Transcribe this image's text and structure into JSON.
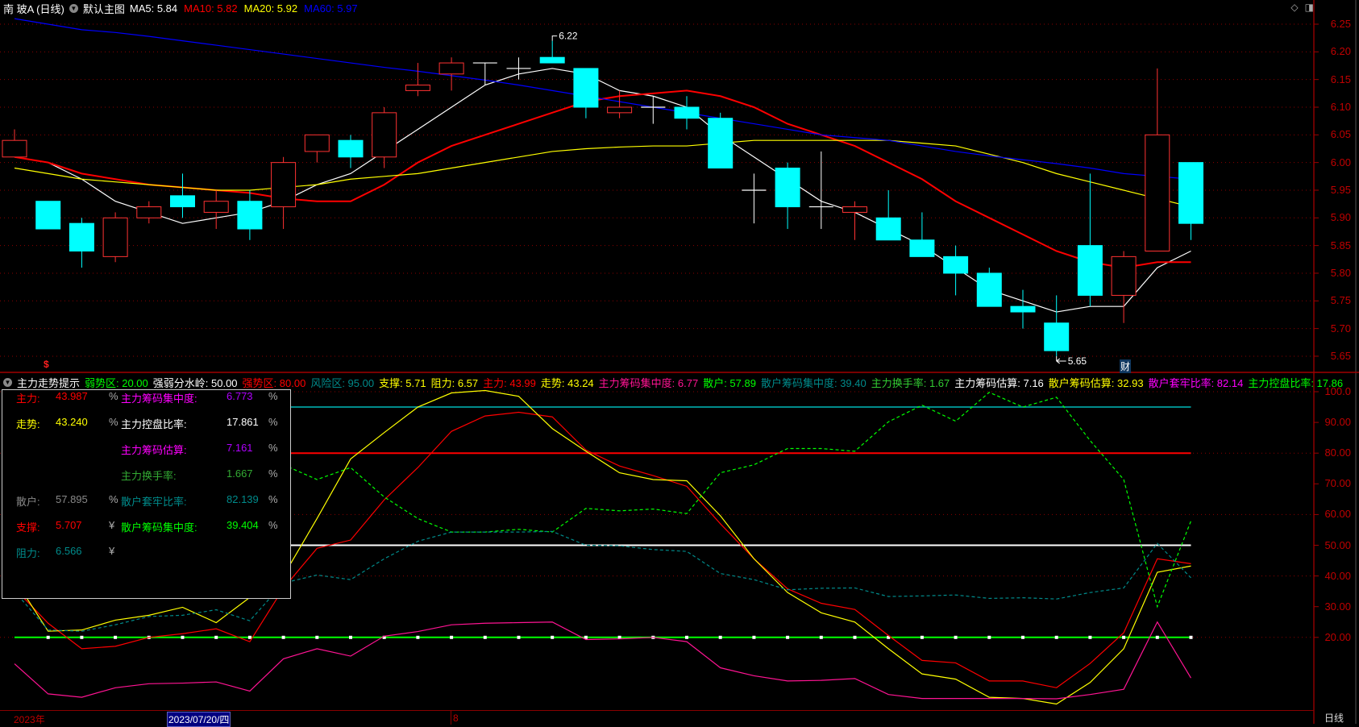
{
  "main_header": {
    "symbol": "南 玻A (日线)",
    "template": "默认主图",
    "ma": [
      {
        "label": "MA5: 5.84",
        "color": "#ffffff"
      },
      {
        "label": "MA10: 5.82",
        "color": "#ff0000"
      },
      {
        "label": "MA20: 5.92",
        "color": "#ffff00"
      },
      {
        "label": "MA60: 5.97",
        "color": "#0000ff"
      }
    ]
  },
  "indicator_header": {
    "name": "主力走势提示",
    "items": [
      {
        "label": "弱势区: 20.00",
        "color": "#00ff00"
      },
      {
        "label": "强弱分水岭: 50.00",
        "color": "#ffffff"
      },
      {
        "label": "强势区: 80.00",
        "color": "#ff0000"
      },
      {
        "label": "风险区: 95.00",
        "color": "#008b8b"
      },
      {
        "label": "支撑: 5.71",
        "color": "#ffff00"
      },
      {
        "label": "阻力: 6.57",
        "color": "#ffff00"
      },
      {
        "label": "主力: 43.99",
        "color": "#ff0000"
      },
      {
        "label": "走势: 43.24",
        "color": "#ffff00"
      },
      {
        "label": "主力筹码集中度: 6.77",
        "color": "#ff1493"
      },
      {
        "label": "散户: 57.89",
        "color": "#00ff00"
      },
      {
        "label": "散户筹码集中度: 39.40",
        "color": "#008b8b"
      },
      {
        "label": "主力换手率: 1.67",
        "color": "#33cc33"
      },
      {
        "label": "主力筹码估算: 7.16",
        "color": "#ffffff"
      },
      {
        "label": "散户筹码估算: 32.93",
        "color": "#ffff00"
      },
      {
        "label": "散户套牢比率: 82.14",
        "color": "#ff00ff"
      },
      {
        "label": "主力控盘比率: 17.86",
        "color": "#00ff00"
      }
    ]
  },
  "info_panel": {
    "rows": [
      {
        "l1": "主力:",
        "v1": "43.987",
        "u1": "%",
        "l2": "主力筹码集中度:",
        "v2": "6.773",
        "u2": "%",
        "c1": "#ff0000",
        "c2": "#ff00ff",
        "cv2": "#b000ff"
      },
      {
        "l1": "走势:",
        "v1": "43.240",
        "u1": "%",
        "l2": "主力控盘比率:",
        "v2": "17.861",
        "u2": "%",
        "c1": "#ffff00",
        "c2": "#ffffff",
        "cv2": "#ffffff"
      },
      {
        "l1": "",
        "v1": "",
        "u1": "",
        "l2": "主力筹码估算:",
        "v2": "7.161",
        "u2": "%",
        "c1": "#fff",
        "c2": "#ff00ff",
        "cv2": "#b000ff"
      },
      {
        "l1": "",
        "v1": "",
        "u1": "",
        "l2": "主力换手率:",
        "v2": "1.667",
        "u2": "%",
        "c1": "#fff",
        "c2": "#33aa33",
        "cv2": "#33aa33"
      },
      {
        "l1": "散户:",
        "v1": "57.895",
        "u1": "%",
        "l2": "散户套牢比率:",
        "v2": "82.139",
        "u2": "%",
        "c1": "#888888",
        "c2": "#008b8b",
        "cv2": "#008b8b"
      },
      {
        "l1": "支撑:",
        "v1": "5.707",
        "u1": "¥",
        "l2": "散户筹码集中度:",
        "v2": "39.404",
        "u2": "%",
        "c1": "#ff0000",
        "c2": "#00ff00",
        "cv2": "#00ff00"
      },
      {
        "l1": "阻力:",
        "v1": "6.566",
        "u1": "¥",
        "l2": "",
        "v2": "",
        "u2": "",
        "c1": "#008b8b",
        "c2": "#fff",
        "cv2": "#fff"
      }
    ]
  },
  "date_axis": {
    "year": "2023年",
    "cursor_date": "2023/07/20/四",
    "month": "8",
    "period": "日线"
  },
  "markers": {
    "event_s": "$",
    "event_cai": "财"
  },
  "colors": {
    "up": "#ff3232",
    "down": "#00ffff",
    "doji": "#ffffff",
    "grid": "#8b0000",
    "axis": "#c00000"
  },
  "chart_data": [
    {
      "type": "candlestick",
      "title": "南 玻A (日线)",
      "ylim": [
        5.62,
        6.27
      ],
      "yticks": [
        "6.25",
        "6.20",
        "6.15",
        "6.10",
        "6.05",
        "6.00",
        "5.95",
        "5.90",
        "5.85",
        "5.80",
        "5.75",
        "5.70",
        "5.65"
      ],
      "max_label": "6.22",
      "min_label": "5.65",
      "candles_ohlc": [
        [
          6.01,
          6.06,
          6.01,
          6.04
        ],
        [
          5.93,
          5.93,
          5.88,
          5.88
        ],
        [
          5.89,
          5.9,
          5.81,
          5.84
        ],
        [
          5.83,
          5.91,
          5.82,
          5.9
        ],
        [
          5.9,
          5.93,
          5.89,
          5.92
        ],
        [
          5.94,
          5.98,
          5.9,
          5.92
        ],
        [
          5.91,
          5.95,
          5.88,
          5.93
        ],
        [
          5.93,
          5.95,
          5.86,
          5.88
        ],
        [
          5.92,
          6.01,
          5.88,
          6.0
        ],
        [
          6.02,
          6.05,
          6.0,
          6.05
        ],
        [
          6.04,
          6.05,
          5.99,
          6.01
        ],
        [
          6.01,
          6.1,
          5.99,
          6.09
        ],
        [
          6.13,
          6.18,
          6.12,
          6.14
        ],
        [
          6.16,
          6.19,
          6.13,
          6.18
        ],
        [
          6.18,
          6.18,
          6.14,
          6.18
        ],
        [
          6.17,
          6.19,
          6.15,
          6.17
        ],
        [
          6.19,
          6.22,
          6.18,
          6.18
        ],
        [
          6.17,
          6.17,
          6.08,
          6.1
        ],
        [
          6.09,
          6.13,
          6.08,
          6.1
        ],
        [
          6.1,
          6.12,
          6.07,
          6.1
        ],
        [
          6.1,
          6.12,
          6.06,
          6.08
        ],
        [
          6.08,
          6.09,
          5.99,
          5.99
        ],
        [
          5.95,
          5.98,
          5.89,
          5.95
        ],
        [
          5.99,
          6.0,
          5.88,
          5.92
        ],
        [
          5.92,
          6.02,
          5.88,
          5.92
        ],
        [
          5.91,
          5.93,
          5.86,
          5.92
        ],
        [
          5.9,
          5.95,
          5.86,
          5.86
        ],
        [
          5.86,
          5.91,
          5.83,
          5.83
        ],
        [
          5.83,
          5.85,
          5.76,
          5.8
        ],
        [
          5.8,
          5.81,
          5.74,
          5.74
        ],
        [
          5.74,
          5.77,
          5.7,
          5.73
        ],
        [
          5.71,
          5.76,
          5.65,
          5.66
        ],
        [
          5.85,
          5.98,
          5.74,
          5.76
        ],
        [
          5.76,
          5.84,
          5.71,
          5.83
        ],
        [
          5.84,
          6.17,
          5.84,
          6.05
        ],
        [
          6.0,
          6.0,
          5.86,
          5.89
        ]
      ],
      "series": [
        {
          "name": "MA5",
          "color": "#ffffff",
          "values": [
            6.01,
            6.0,
            5.97,
            5.93,
            5.91,
            5.89,
            5.9,
            5.91,
            5.93,
            5.96,
            5.98,
            6.02,
            6.06,
            6.1,
            6.14,
            6.16,
            6.17,
            6.16,
            6.13,
            6.12,
            6.1,
            6.05,
            6.01,
            5.97,
            5.93,
            5.91,
            5.88,
            5.85,
            5.81,
            5.77,
            5.75,
            5.73,
            5.74,
            5.74,
            5.81,
            5.84
          ]
        },
        {
          "name": "MA10",
          "color": "#ff0000",
          "values": [
            6.01,
            6.0,
            5.98,
            5.97,
            5.96,
            5.955,
            5.95,
            5.945,
            5.935,
            5.93,
            5.93,
            5.96,
            6.0,
            6.03,
            6.05,
            6.07,
            6.09,
            6.11,
            6.12,
            6.125,
            6.13,
            6.12,
            6.1,
            6.07,
            6.05,
            6.03,
            6.0,
            5.97,
            5.93,
            5.9,
            5.87,
            5.84,
            5.82,
            5.81,
            5.82,
            5.82
          ]
        },
        {
          "name": "MA20",
          "color": "#ffff00",
          "values": [
            5.99,
            5.98,
            5.97,
            5.965,
            5.96,
            5.955,
            5.95,
            5.95,
            5.955,
            5.96,
            5.97,
            5.975,
            5.98,
            5.99,
            6.0,
            6.01,
            6.02,
            6.025,
            6.028,
            6.03,
            6.03,
            6.035,
            6.04,
            6.04,
            6.04,
            6.04,
            6.04,
            6.035,
            6.03,
            6.015,
            6.0,
            5.98,
            5.965,
            5.95,
            5.935,
            5.92
          ]
        },
        {
          "name": "MA60",
          "color": "#0000ff",
          "values": [
            6.26,
            6.25,
            6.24,
            6.235,
            6.228,
            6.22,
            6.212,
            6.204,
            6.196,
            6.188,
            6.18,
            6.172,
            6.165,
            6.157,
            6.149,
            6.14,
            6.13,
            6.12,
            6.11,
            6.1,
            6.09,
            6.08,
            6.07,
            6.06,
            6.05,
            6.045,
            6.04,
            6.03,
            6.02,
            6.012,
            6.005,
            5.998,
            5.99,
            5.98,
            5.975,
            5.97
          ]
        }
      ]
    },
    {
      "type": "line",
      "title": "主力走势提示",
      "ylim": [
        -4,
        101
      ],
      "yticks": [
        "100.0",
        "90.00",
        "80.00",
        "70.00",
        "60.00",
        "50.00",
        "40.00",
        "30.00",
        "20.00"
      ],
      "reference_lines": [
        {
          "name": "风险区",
          "value": 95,
          "color": "#008b8b"
        },
        {
          "name": "强势区",
          "value": 80,
          "color": "#ff0000"
        },
        {
          "name": "强弱分水岭",
          "value": 50,
          "color": "#ffffff"
        },
        {
          "name": "弱势区",
          "value": 20,
          "color": "#00ff00"
        }
      ],
      "series": [
        {
          "name": "主力",
          "color": "#ff0000",
          "dash": false,
          "values": [
            36,
            24.6,
            16.3,
            17.1,
            20,
            21.2,
            22.8,
            18.6,
            36,
            49,
            51.7,
            64.8,
            75.3,
            87.1,
            92.1,
            93.3,
            91.8,
            81,
            75.8,
            72.7,
            69.2,
            57,
            45.6,
            35.8,
            31.1,
            29.1,
            20.6,
            12.5,
            11.7,
            5.8,
            5.8,
            3.6,
            11.5,
            21.5,
            45.6,
            43.99
          ]
        },
        {
          "name": "走势",
          "color": "#ffff00",
          "dash": false,
          "values": [
            39,
            22,
            22.4,
            25.6,
            27.2,
            29.8,
            24.8,
            33,
            40,
            58.7,
            78.1,
            86.7,
            95,
            99.6,
            100.4,
            98.5,
            88,
            80.6,
            73.6,
            71.4,
            71,
            59.6,
            45.6,
            34.6,
            28,
            25,
            16.3,
            8.1,
            6.4,
            0.5,
            0.1,
            -1.7,
            5.3,
            16.3,
            41.2,
            43.24
          ]
        },
        {
          "name": "主力筹码集中度",
          "color": "#ff1493",
          "dash": false,
          "values": [
            11.4,
            1.6,
            0.5,
            3.6,
            4.9,
            5.1,
            5.5,
            2.5,
            13,
            16.3,
            13.9,
            20.4,
            21.9,
            24.1,
            24.6,
            24.8,
            25,
            19.3,
            19.5,
            20,
            18.6,
            10.1,
            7.5,
            5.8,
            6,
            6.6,
            1.4,
            0.1,
            0.1,
            0.1,
            0.1,
            0,
            1.4,
            3.1,
            25,
            6.77
          ]
        },
        {
          "name": "散户",
          "color": "#00ff00",
          "dash": true,
          "values": [
            null,
            null,
            null,
            null,
            null,
            null,
            null,
            null,
            76.2,
            71.4,
            75.3,
            65.7,
            58.7,
            54.3,
            54.3,
            55.2,
            54.3,
            62,
            61.2,
            61.8,
            60.3,
            73.6,
            76.2,
            81.5,
            81.5,
            80.6,
            90.2,
            95.6,
            90.4,
            99.8,
            95,
            98.2,
            84.1,
            71.4,
            30,
            57.89
          ]
        },
        {
          "name": "散户筹码集中度",
          "color": "#008b8b",
          "dash": true,
          "values": [
            35,
            22.4,
            22,
            24.1,
            26.8,
            27.2,
            29,
            25.4,
            37.7,
            40.3,
            38.8,
            45.6,
            51.3,
            54.3,
            54.3,
            54.3,
            54.5,
            50,
            49.8,
            48.6,
            48,
            40.8,
            38.8,
            35.5,
            36,
            36.1,
            33.3,
            33.5,
            33.8,
            32.7,
            32.9,
            32.5,
            34.6,
            36.1,
            50.6,
            39.4
          ]
        }
      ]
    }
  ]
}
